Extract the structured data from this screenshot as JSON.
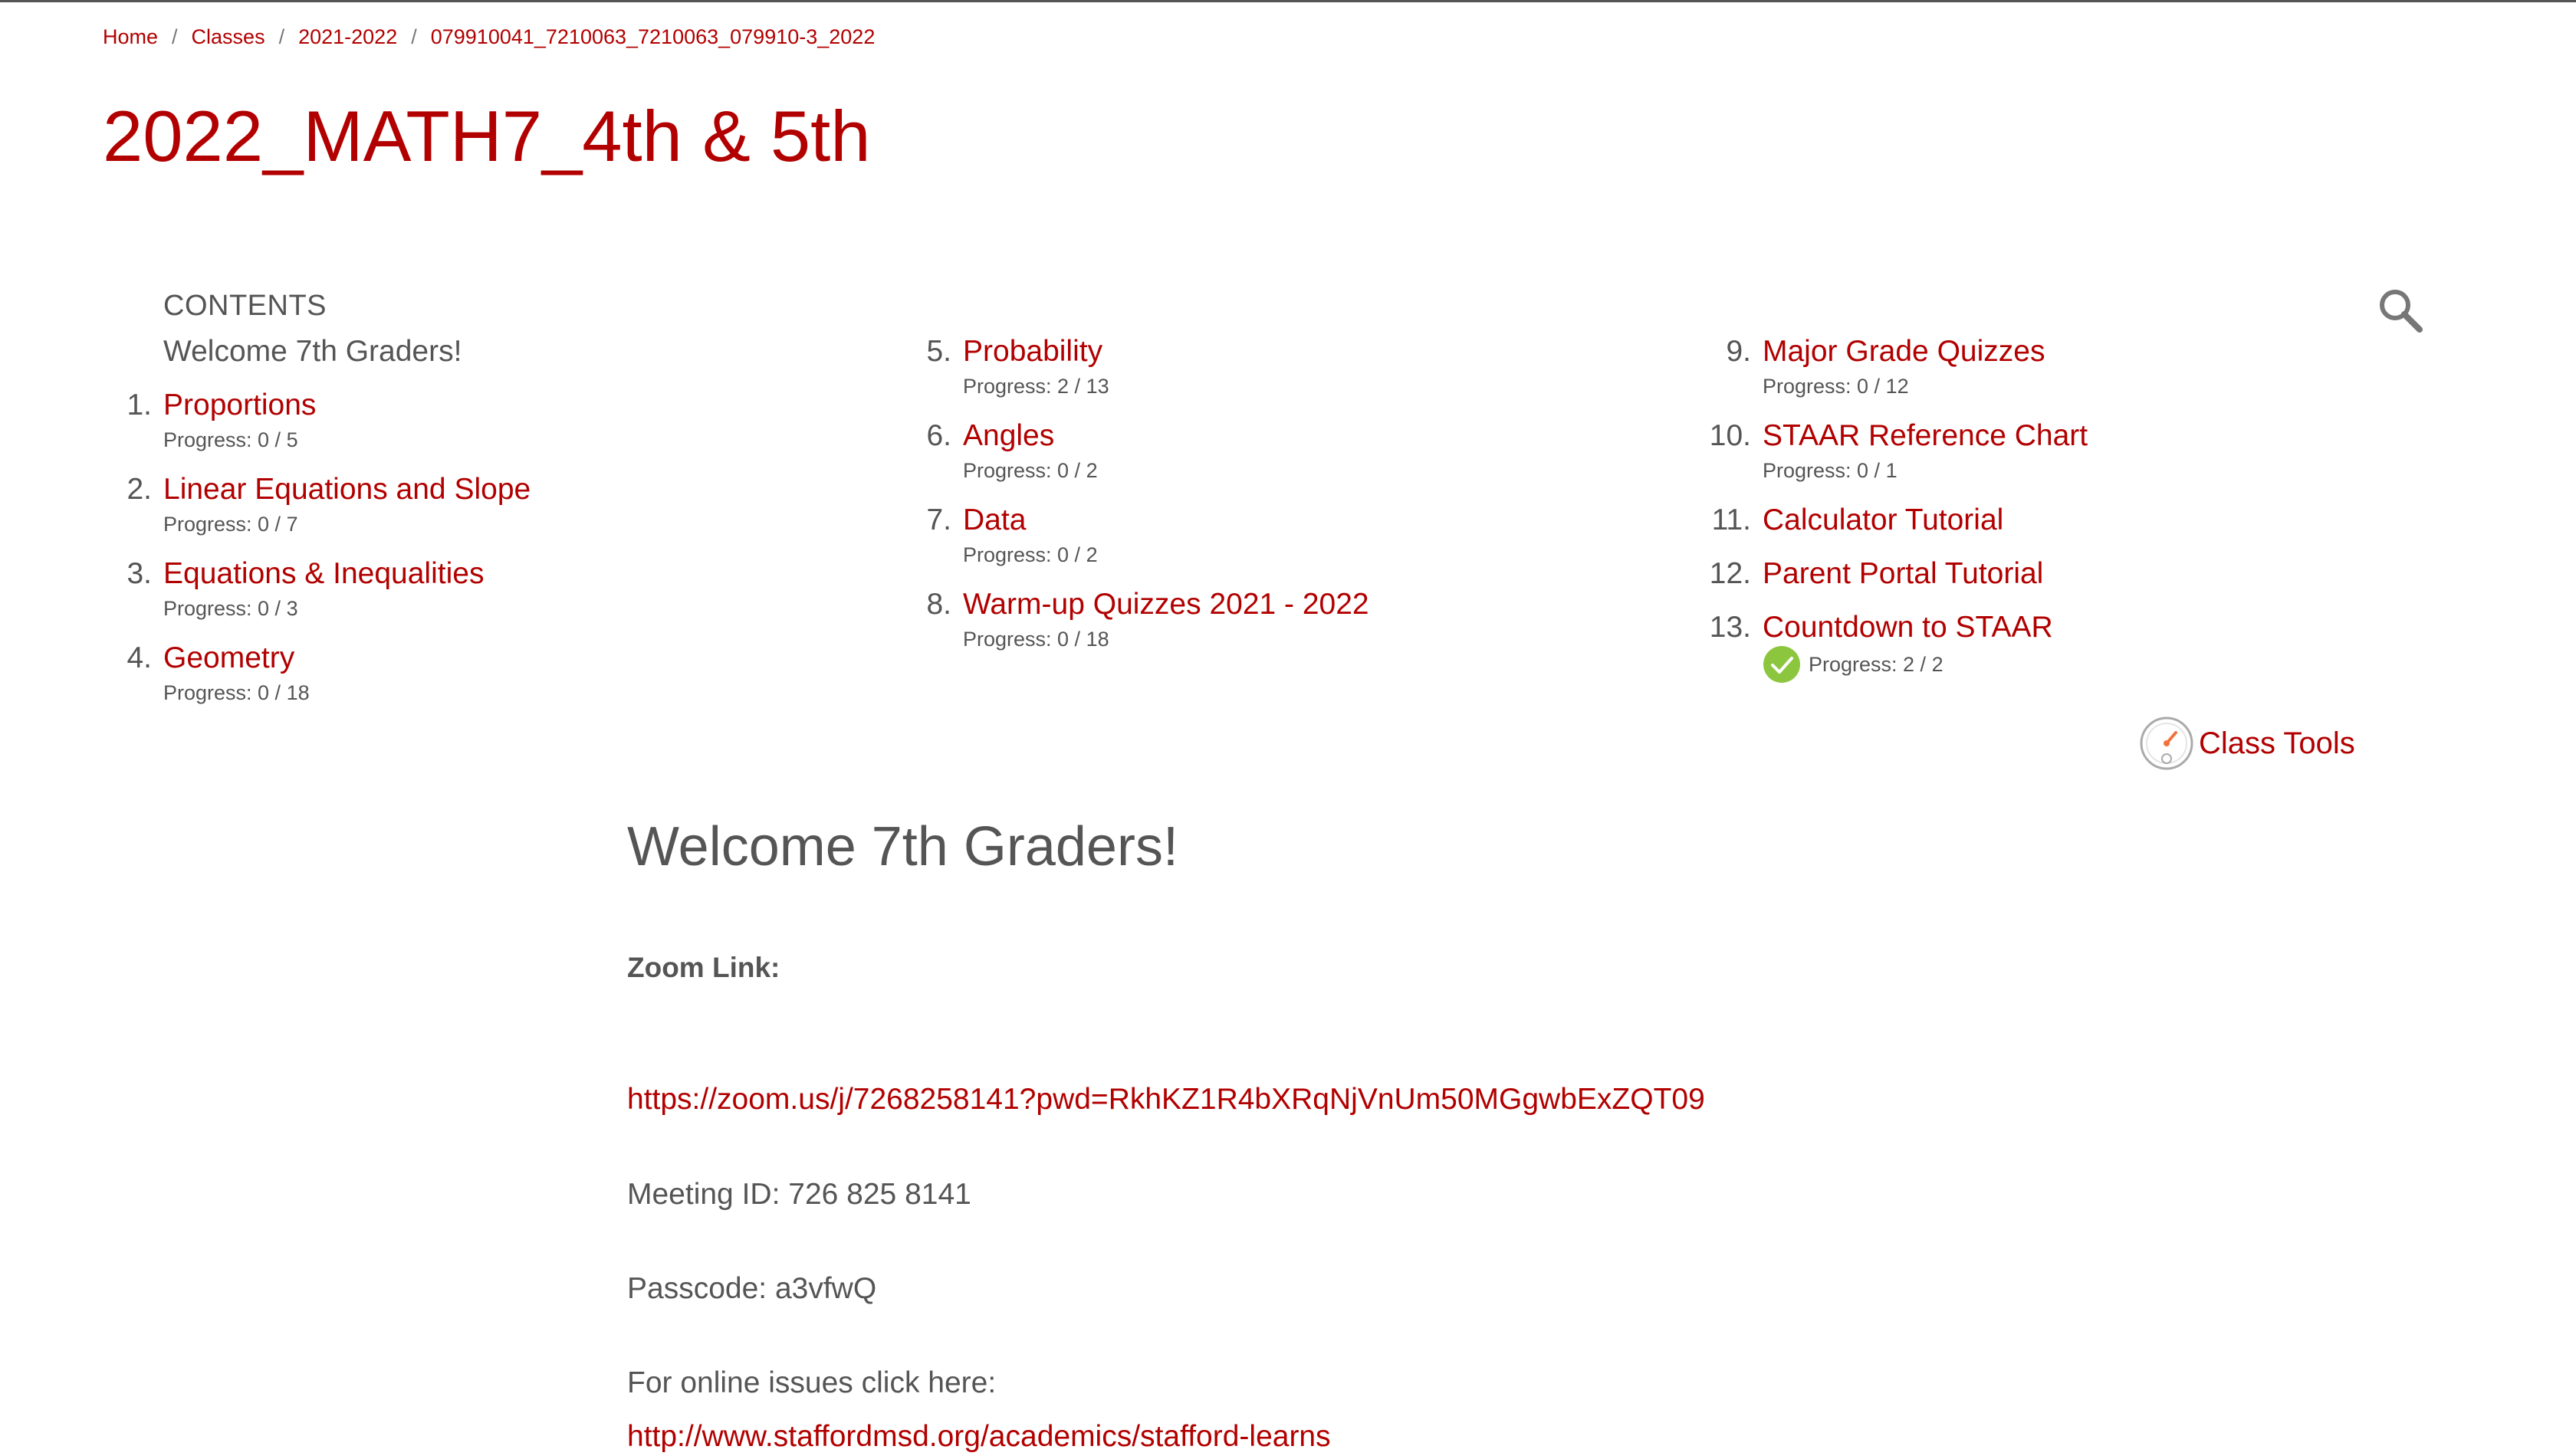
{
  "breadcrumb": {
    "items": [
      "Home",
      "Classes",
      "2021-2022",
      "079910041_7210063_7210063_079910-3_2022"
    ],
    "separator": "/"
  },
  "page": {
    "title": "2022_MATH7_4th & 5th"
  },
  "contents": {
    "label": "CONTENTS",
    "welcome_item": "Welcome 7th Graders!",
    "columns": [
      [
        {
          "num": "1.",
          "label": "Proportions",
          "progress": "Progress: 0 / 5"
        },
        {
          "num": "2.",
          "label": "Linear Equations and Slope",
          "progress": "Progress: 0 / 7"
        },
        {
          "num": "3.",
          "label": "Equations & Inequalities",
          "progress": "Progress: 0 / 3"
        },
        {
          "num": "4.",
          "label": "Geometry",
          "progress": "Progress: 0 / 18"
        }
      ],
      [
        {
          "num": "5.",
          "label": "Probability",
          "progress": "Progress: 2 / 13"
        },
        {
          "num": "6.",
          "label": "Angles",
          "progress": "Progress: 0 / 2"
        },
        {
          "num": "7.",
          "label": "Data",
          "progress": "Progress: 0 / 2"
        },
        {
          "num": "8.",
          "label": "Warm-up Quizzes 2021 - 2022",
          "progress": "Progress: 0 / 18"
        }
      ],
      [
        {
          "num": "9.",
          "label": "Major Grade Quizzes",
          "progress": "Progress: 0 / 12"
        },
        {
          "num": "10.",
          "label": "STAAR Reference Chart",
          "progress": "Progress: 0 / 1"
        },
        {
          "num": "11.",
          "label": "Calculator Tutorial",
          "progress": ""
        },
        {
          "num": "12.",
          "label": "Parent Portal Tutorial",
          "progress": ""
        },
        {
          "num": "13.",
          "label": "Countdown to STAAR",
          "progress": "Progress: 2 / 2",
          "completed": true
        }
      ]
    ]
  },
  "class_tools": {
    "label": "Class Tools",
    "icon": "gauge-icon"
  },
  "search": {
    "icon": "search-icon"
  },
  "main": {
    "heading": "Welcome 7th Graders!",
    "zoom_label": "Zoom Link:",
    "zoom_url": "https://zoom.us/j/7268258141?pwd=RkhKZ1R4bXRqNjVnUm50MGgwbExZQT09",
    "meeting_id": "Meeting ID: 726 825 8141",
    "passcode": "Passcode: a3vfwQ",
    "online_issues": "For online issues click here:",
    "online_issues_url": "http://www.staffordmsd.org/academics/stafford-learns"
  },
  "colors": {
    "accent": "#b20000",
    "text": "#555555",
    "success": "#8cc63f"
  }
}
